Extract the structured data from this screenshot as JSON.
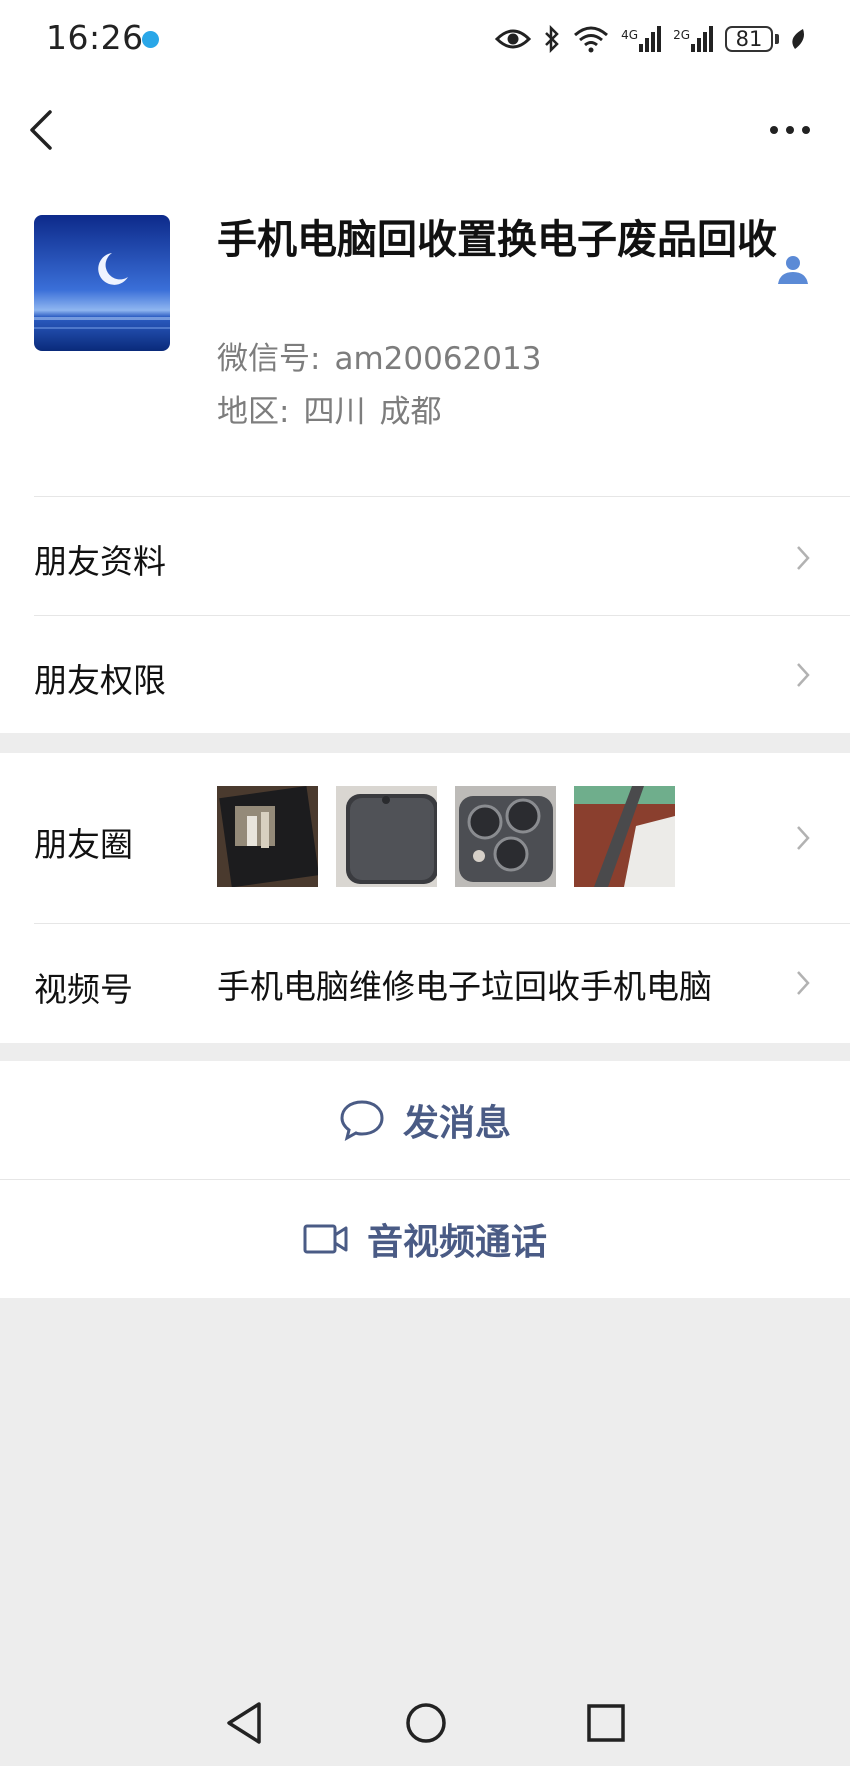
{
  "status": {
    "time": "16:26",
    "battery": "81",
    "signal_1": "4G",
    "signal_2": "2G"
  },
  "profile": {
    "name": "手机电脑回收置换电子废品回收",
    "wechat_id_label": "微信号:",
    "wechat_id": "am20062013",
    "region_label": "地区:",
    "province": "四川",
    "city": "成都"
  },
  "menu": {
    "friend_profile": "朋友资料",
    "friend_permissions": "朋友权限",
    "moments": "朋友圈",
    "channels": "视频号",
    "channels_value": "手机电脑维修电子垃回收手机电脑"
  },
  "actions": {
    "send_message": "发消息",
    "voice_video_call": "音视频通话"
  },
  "icons": [
    "back-icon",
    "more-icon",
    "person-icon",
    "chevron-right-icon",
    "chat-bubble-icon",
    "video-camera-icon",
    "eye-icon",
    "bluetooth-icon",
    "wifi-icon",
    "battery-icon",
    "nav-back-icon",
    "nav-home-icon",
    "nav-recents-icon"
  ],
  "colors": {
    "accent": "#4a5b85",
    "person_icon": "#5b8ad6",
    "background": "#ededed"
  }
}
